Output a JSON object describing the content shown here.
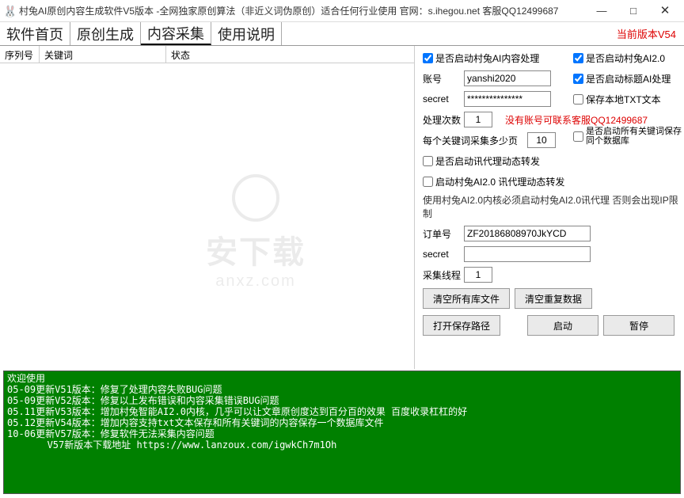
{
  "window": {
    "icon": "🐰",
    "title": "村兔AI原创内容生成软件V5版本 -全网独家原创算法（非近义词伪原创）适合任何行业使用 官网：s.ihegou.net 客服QQ12499687",
    "min": "—",
    "max": "□",
    "close": "✕"
  },
  "tabs": {
    "home": "软件首页",
    "gen": "原创生成",
    "collect": "内容采集",
    "help": "使用说明",
    "version": "当前版本V54"
  },
  "list": {
    "col1": "序列号",
    "col2": "关键词",
    "col3": "状态"
  },
  "settings": {
    "chk_ai": "是否启动村兔AI内容处理",
    "chk_ai20": "是否启动村兔AI2.0",
    "chk_title_ai": "是否启动标题AI处理",
    "chk_save_txt": "保存本地TXT文本",
    "chk_all_db": "是否启动所有关键词保存同个数据库",
    "account_label": "账号",
    "account_value": "yanshi2020",
    "secret_label": "secret",
    "secret_value": "***************",
    "count_label": "处理次数",
    "count_value": "1",
    "no_account_hint": "没有账号可联系客服QQ12499687",
    "pages_label": "每个关键词采集多少页",
    "pages_value": "10",
    "chk_proxy": "是否启动讯代理动态转发",
    "chk_ai20_proxy": "启动村兔AI2.0 讯代理动态转发",
    "ai20_note": "使用村兔AI2.0内核必须启动村兔AI2.0讯代理 否则会出现IP限制",
    "order_label": "订单号",
    "order_value": "ZF20186808970JkYCD",
    "secret2_label": "secret",
    "secret2_value": "",
    "threads_label": "采集线程",
    "threads_value": "1",
    "btn_clear_lib": "清空所有库文件",
    "btn_clear_dup": "清空重复数据",
    "btn_open_path": "打开保存路径",
    "btn_start": "启动",
    "btn_pause": "暂停"
  },
  "console": "欢迎使用\n05-09更新V51版本：修复了处理内容失败BUG问题\n05-09更新V52版本：修复以上发布错误和内容采集错误BUG问题\n05.11更新V53版本：增加村兔智能AI2.0内核，几乎可以让文章原创度达到百分百的效果 百度收录杠杠的好\n05.12更新V54版本：增加内容支持txt文本保存和所有关键词的内容保存一个数据库文件\n10-06更新V57版本：修复软件无法采集内容问题\n       V57新版本下载地址 https://www.lanzoux.com/igwkCh7m1Oh",
  "watermark": {
    "line1": "安下载",
    "line2": "anxz.com"
  }
}
